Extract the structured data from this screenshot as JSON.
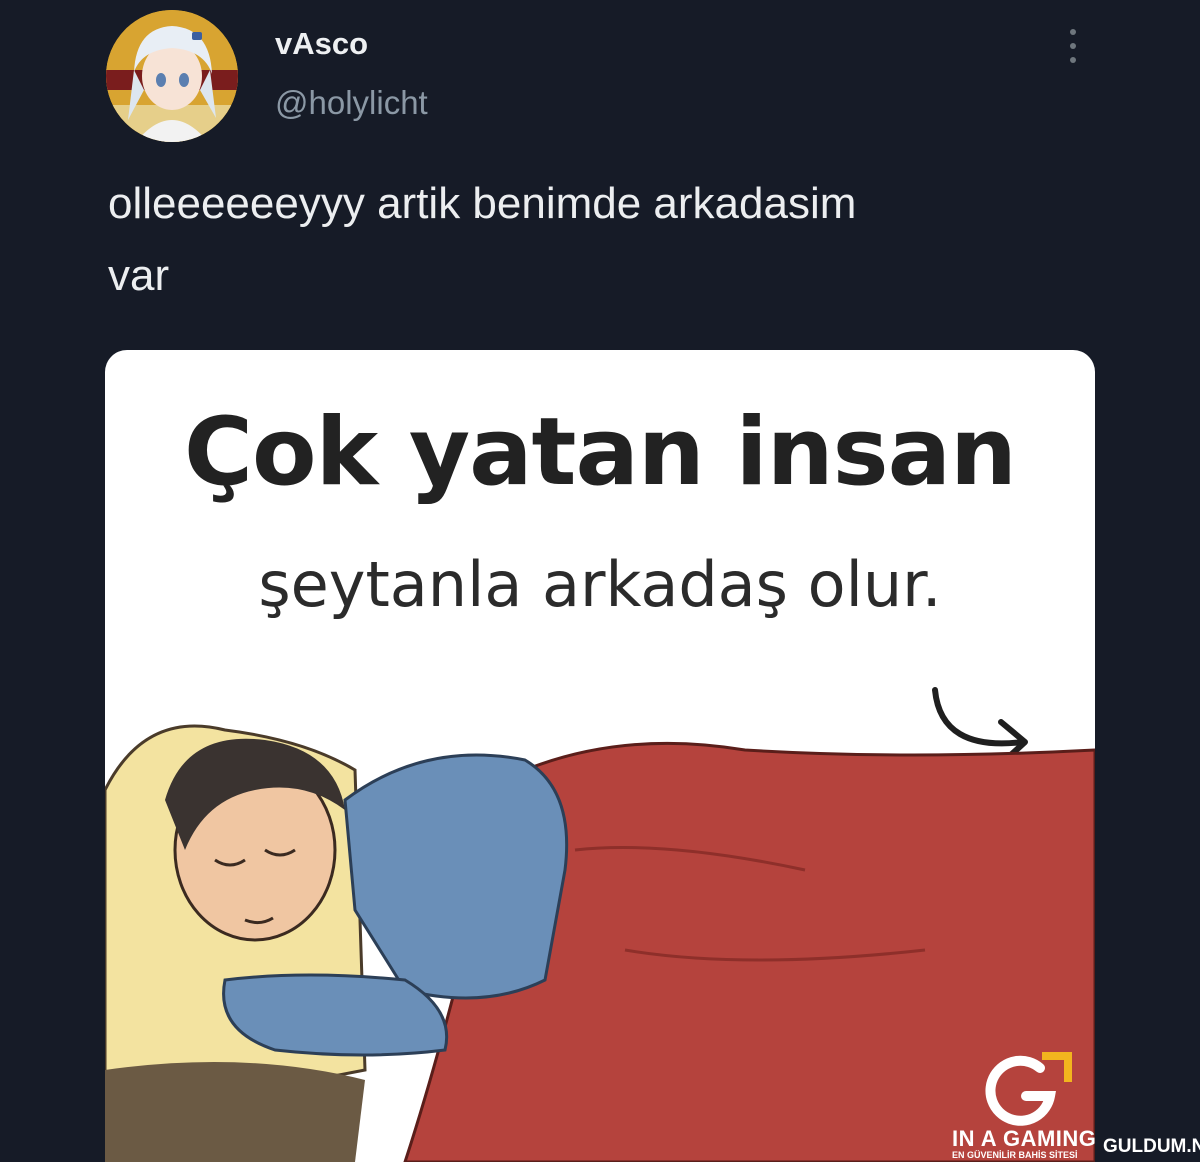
{
  "tweet": {
    "display_name": "vAsco",
    "handle": "@holylicht",
    "text": "olleeeeeeyyy artik benimde arkadasim\nvar",
    "avatar_icon": "anime-avatar-icon",
    "more_icon": "more-vertical-icon"
  },
  "media": {
    "headline": "Çok yatan insan",
    "subline": "şeytanla arkadaş olur.",
    "illustration": "sleeping-man-under-red-blanket",
    "arrow_icon": "curved-arrow-icon"
  },
  "watermark": {
    "brand": "IN A GAMING",
    "tagline": "EN GÜVENİLİR BAHİS SİTESİ",
    "site": "GULDUM.NET",
    "logo_icon": "g-logo-icon",
    "accent": "#f2b51e"
  },
  "colors": {
    "background": "#161b27",
    "blanket": "#b5433d",
    "sweater": "#6a8fb8"
  }
}
